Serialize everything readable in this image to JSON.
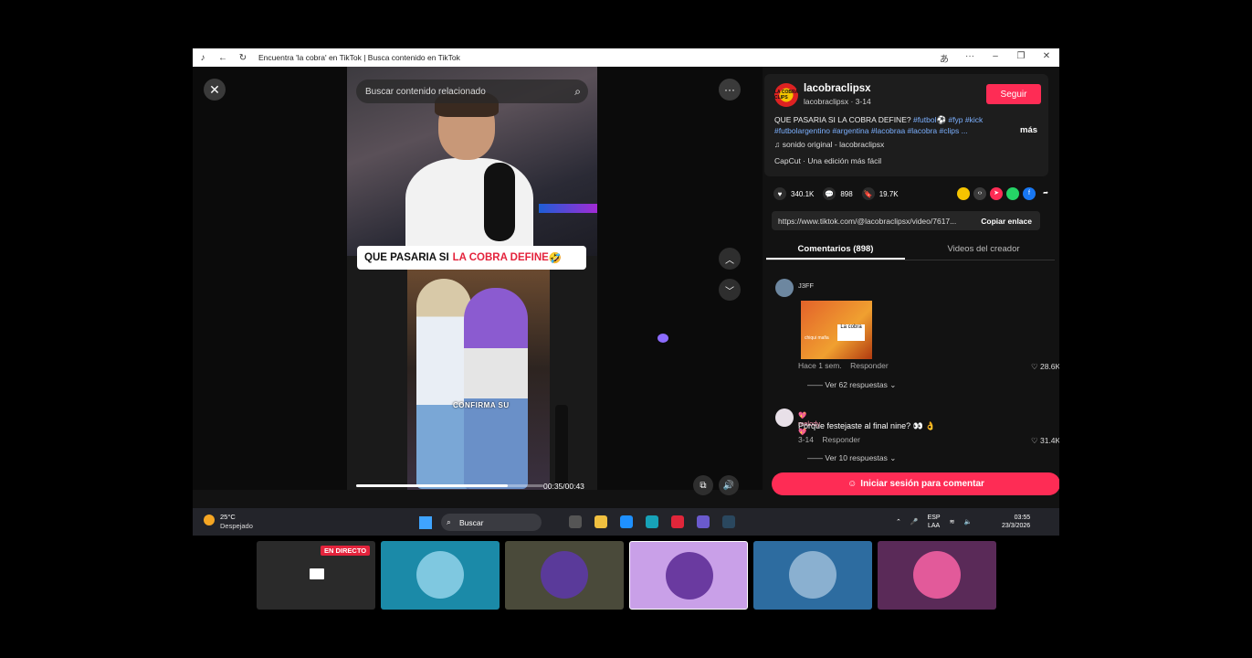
{
  "window": {
    "title": "Encuentra 'la cobra' en TikTok | Busca contenido en TikTok"
  },
  "video": {
    "search_placeholder": "Buscar contenido relacionado",
    "caption_prefix": "QUE PASARIA SI",
    "caption_highlight": "LA COBRA DEFINE",
    "caption_emoji": "🤣",
    "overlay_text": "CONFIRMA SU",
    "time": "00:35/00:43",
    "progress": 0.81
  },
  "post": {
    "handle": "lacobraclipsx",
    "subline": "lacobraclipsx · 3-14",
    "avatar_text": "LA COBRA CLIPS",
    "follow_label": "Seguir",
    "desc_line1_text": "QUE PASARIA SI LA COBRA DEFINE?",
    "desc_line1_tags": "#futbol⚽ #fyp #kick",
    "desc_line2_tags": "#futbolargentino #argentina #lacobraa #lacobra #clips ...",
    "more_label": "más",
    "sound": "♫  sonido original - lacobraclipsx",
    "capcut": "CapCut · Una edición más fácil",
    "likes": "340.1K",
    "comments": "898",
    "saves": "19.7K",
    "link": "https://www.tiktok.com/@lacobraclipsx/video/7617...",
    "copy_label": "Copiar enlace",
    "tab_comments": "Comentarios (898)",
    "tab_creator": "Videos del creador",
    "login_label": "Iniciar sesión para comentar"
  },
  "comments": [
    {
      "user": "J3FF",
      "meme_text": "La cobra",
      "meme_text_small": "chiqui mafia",
      "time": "Hace 1 sem.",
      "reply": "Responder",
      "likes": "28.6K",
      "more": "Ver 62 respuestas"
    },
    {
      "user": "💖 melody 💖",
      "text": "Porque festejaste al final nine? 👀 👌",
      "time": "3-14",
      "reply": "Responder",
      "likes": "31.4K",
      "more": "Ver 10 respuestas"
    }
  ],
  "taskbar": {
    "temp": "25°C",
    "condition": "Despejado",
    "search": "Buscar",
    "lang_top": "ESP",
    "lang_bottom": "LAA",
    "time": "03:55",
    "date": "23/3/2026"
  },
  "thumbs": {
    "live_label": "EN DIRECTO"
  },
  "colors": {
    "accent": "#fe2c55",
    "hashtag": "#7cb0ff",
    "caption_red": "#e4233c"
  }
}
